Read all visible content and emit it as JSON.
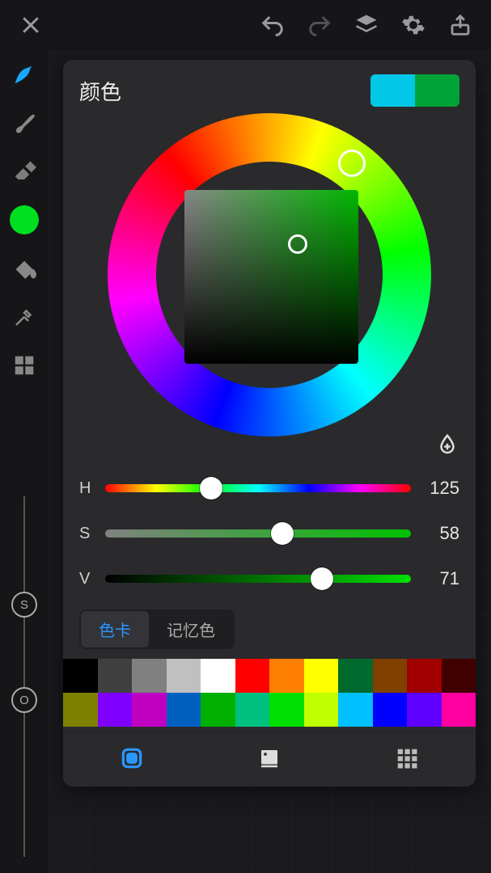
{
  "panel_title": "颜色",
  "current_color": "#00c8e6",
  "secondary_color": "#00a336",
  "hsv": {
    "h": 125,
    "s": 58,
    "v": 71
  },
  "labels": {
    "h": "H",
    "s": "S",
    "v": "V"
  },
  "tabs": {
    "card": "色卡",
    "memory": "记忆色"
  },
  "vslider_labels": {
    "size": "S",
    "opacity": "O"
  },
  "palette_rows": [
    [
      "#000000",
      "#404040",
      "#808080",
      "#c0c0c0",
      "#ffffff",
      "#ff0000",
      "#ff8000",
      "#ffff00",
      "#006a2e",
      "#804000",
      "#a00000",
      "#400000"
    ],
    [
      "#808000",
      "#8000ff",
      "#c000c0",
      "#0060c0",
      "#00b000",
      "#00c080",
      "#00e000",
      "#c0ff00",
      "#00c0ff",
      "#0000ff",
      "#6000ff",
      "#ff00a0"
    ]
  ]
}
